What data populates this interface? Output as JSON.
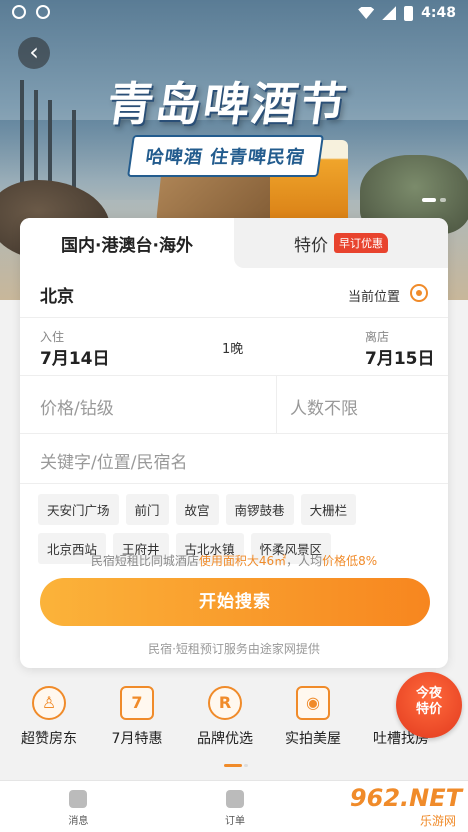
{
  "status_bar": {
    "time": "4:48"
  },
  "banner": {
    "title": "青岛啤酒节",
    "subtitle": "哈啤酒 住青啤民宿"
  },
  "tabs": [
    {
      "label": "国内·港澳台·海外"
    },
    {
      "label": "特价",
      "badge": "早订优惠"
    }
  ],
  "search": {
    "city": "北京",
    "current_location": "当前位置",
    "checkin_label": "入住",
    "checkin_date": "7月14日",
    "nights": "1晚",
    "checkout_label": "离店",
    "checkout_date": "7月15日",
    "price_placeholder": "价格/钻级",
    "guests_placeholder": "人数不限",
    "keyword_placeholder": "关键字/位置/民宿名"
  },
  "tags": [
    "天安门广场",
    "前门",
    "故宫",
    "南锣鼓巷",
    "大栅栏",
    "北京西站",
    "王府井",
    "古北水镇",
    "怀柔风景区"
  ],
  "compare": {
    "prefix": "民宿短租比同城酒店",
    "area": "使用面积大46㎡",
    "mid": "，人均",
    "price": "价格低8%"
  },
  "search_button": "开始搜索",
  "provider_note": "民宿·短租预订服务由途家网提供",
  "categories": [
    {
      "label": "超赞房东",
      "icon": "host-icon"
    },
    {
      "label": "7月特惠",
      "icon": "calendar-icon"
    },
    {
      "label": "品牌优选",
      "icon": "brand-icon",
      "glyph": "R"
    },
    {
      "label": "实拍美屋",
      "icon": "camera-icon"
    },
    {
      "label": "吐槽找房",
      "icon": "chat-icon"
    }
  ],
  "promo": {
    "line1": "今夜",
    "line2": "特价"
  },
  "bottom_nav": [
    {
      "label": "消息",
      "icon": "message-icon"
    },
    {
      "label": "订单",
      "icon": "order-icon"
    }
  ],
  "watermark": {
    "brand": "962.NET",
    "sub": "乐游网"
  },
  "colors": {
    "accent": "#f08b2a",
    "badge": "#e8432e",
    "button_start": "#fbb33a",
    "button_end": "#f7861f"
  }
}
